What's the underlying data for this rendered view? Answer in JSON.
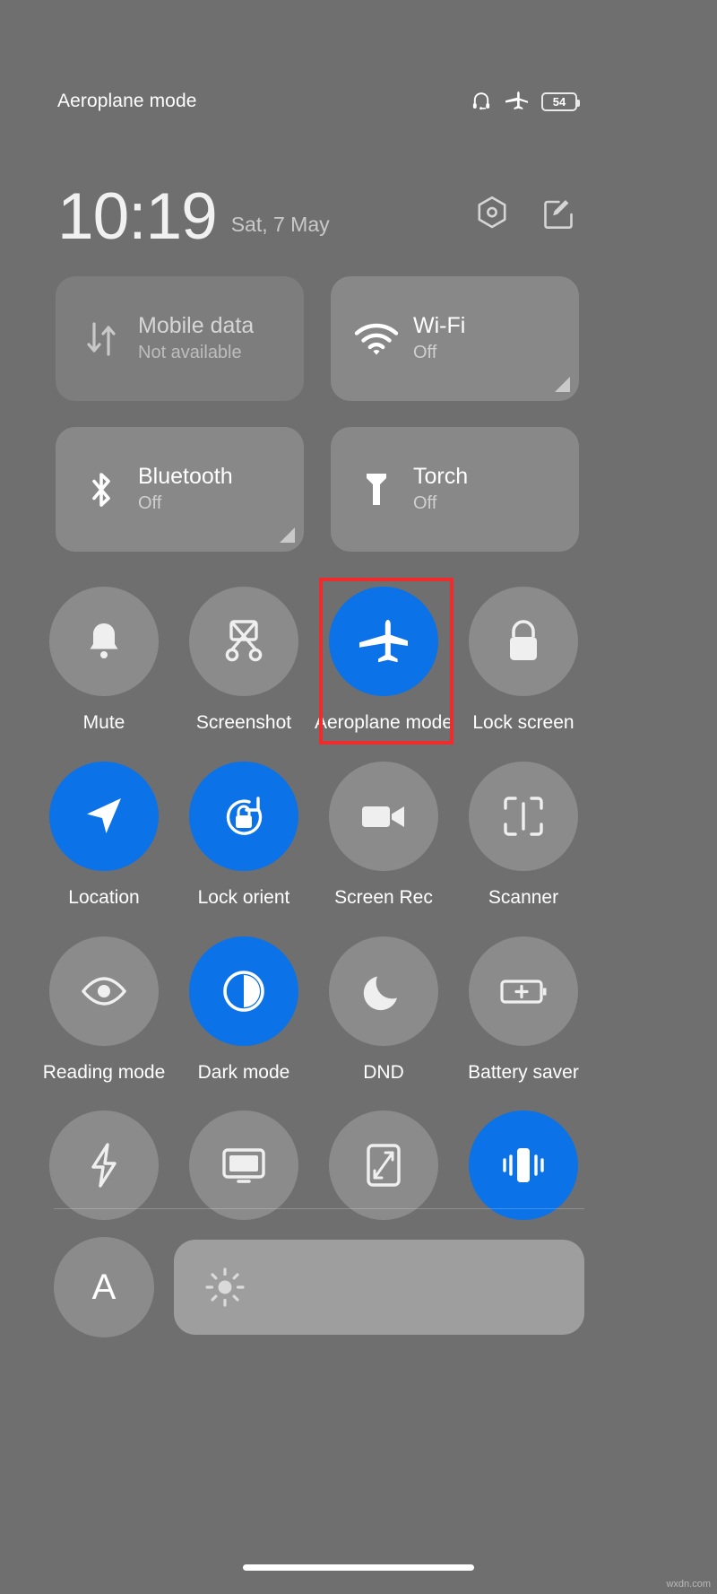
{
  "statusbar": {
    "title": "Aeroplane mode",
    "icons": [
      "headphones-icon",
      "airplane-icon"
    ],
    "battery_level": "54"
  },
  "clock": {
    "time": "10:19",
    "date": "Sat, 7 May",
    "settings_icon": "hexagon-settings-icon",
    "edit_icon": "edit-pencil-icon"
  },
  "tiles": [
    {
      "title": "Mobile data",
      "subtitle": "Not available",
      "state": "dim",
      "icon": "data-transfer-icon",
      "expandable": false
    },
    {
      "title": "Wi-Fi",
      "subtitle": "Off",
      "state": "lit",
      "icon": "wifi-icon",
      "expandable": true
    },
    {
      "title": "Bluetooth",
      "subtitle": "Off",
      "state": "lit",
      "icon": "bluetooth-icon",
      "expandable": true
    },
    {
      "title": "Torch",
      "subtitle": "Off",
      "state": "lit",
      "icon": "torch-icon",
      "expandable": false
    }
  ],
  "toggles": [
    {
      "label": "Mute",
      "icon": "bell-mute-icon",
      "on": false,
      "highlighted": false
    },
    {
      "label": "Screenshot",
      "icon": "screenshot-icon",
      "on": false,
      "highlighted": false
    },
    {
      "label": "Aeroplane mode",
      "icon": "airplane-icon",
      "on": true,
      "highlighted": true
    },
    {
      "label": "Lock screen",
      "icon": "padlock-icon",
      "on": false,
      "highlighted": false
    },
    {
      "label": "Location",
      "icon": "location-arrow-icon",
      "on": true,
      "highlighted": false
    },
    {
      "label": "Lock orient",
      "icon": "rotation-lock-icon",
      "on": true,
      "highlighted": false
    },
    {
      "label": "Screen Rec",
      "icon": "camcorder-icon",
      "on": false,
      "highlighted": false
    },
    {
      "label": "Scanner",
      "icon": "scan-frame-icon",
      "on": false,
      "highlighted": false
    },
    {
      "label": "Reading mode",
      "icon": "eye-icon",
      "on": false,
      "highlighted": false
    },
    {
      "label": "Dark mode",
      "icon": "contrast-circle-icon",
      "on": true,
      "highlighted": false
    },
    {
      "label": "DND",
      "icon": "moon-icon",
      "on": false,
      "highlighted": false
    },
    {
      "label": "Battery saver",
      "icon": "battery-plus-icon",
      "on": false,
      "highlighted": false
    }
  ],
  "toggles_unlabelled": [
    {
      "label": "",
      "icon": "lightning-bolt-icon",
      "on": false
    },
    {
      "label": "",
      "icon": "cast-screen-icon",
      "on": false
    },
    {
      "label": "",
      "icon": "resize-screen-icon",
      "on": false
    },
    {
      "label": "",
      "icon": "vibration-icon",
      "on": true
    }
  ],
  "brightness": {
    "auto_label": "A",
    "slider_icon": "sun-brightness-icon"
  },
  "colors": {
    "accent_blue": "#0b72e7",
    "highlight_red": "#ef2b2b",
    "background_grey": "#6f6f6f"
  },
  "watermark": "wxdn.com"
}
